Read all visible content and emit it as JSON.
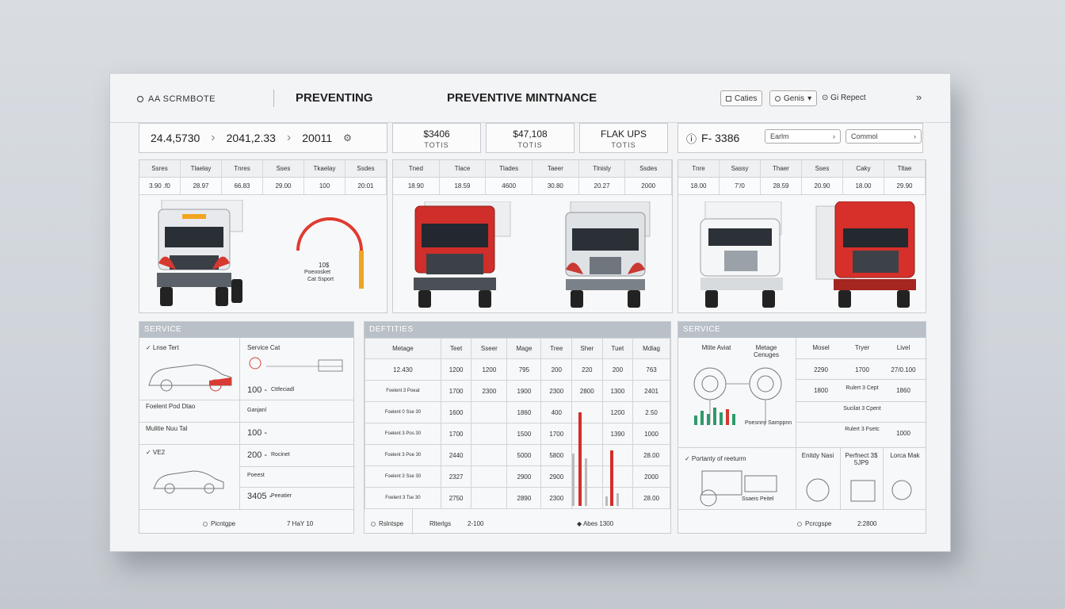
{
  "header": {
    "brand": "AA SCRMBOTE",
    "title_left": "PREVENTING",
    "title_main": "PREVENTIVE MINTNANCE",
    "btn1": "Caties",
    "btn2": "Genis",
    "link": "Gi Repect",
    "chevron": "»"
  },
  "metrics": [
    "24.4,5730",
    "2041,2.33",
    "20011"
  ],
  "cards": [
    {
      "value": "$3406",
      "sub": "TOTIS"
    },
    {
      "value": "$47,108",
      "sub": "TOTIS"
    },
    {
      "value": "FLAK UPS",
      "sub": "TOTIS"
    }
  ],
  "filter": {
    "id": "F- 3386",
    "select1": "Earlm",
    "select2": "Commol"
  },
  "truck_panels": [
    {
      "headers": [
        "Ssres",
        "Tlaelay",
        "Tnres",
        "Sses",
        "Tkaelay",
        "Ssdes"
      ],
      "values": [
        "3.90 .f0",
        "28.97",
        "66.83",
        "29.00",
        "100",
        "20:01"
      ]
    },
    {
      "headers": [
        "Tned",
        "Tlace",
        "Tlades",
        "Taeer",
        "Tlnisly",
        "Ssdes"
      ],
      "values": [
        "18.90",
        "18.59",
        "4600",
        "30.80",
        "20.27",
        "2000"
      ]
    },
    {
      "headers": [
        "Tnre",
        "Sassy",
        "Thaer",
        "Sses",
        "Caky",
        "Tltae"
      ],
      "values": [
        "18.00",
        "7'/0",
        "28.59",
        "20.90",
        "18.00",
        "29.90"
      ]
    }
  ],
  "gauge": {
    "value": "10$",
    "label1": "Poeoosket",
    "label2": "Cat Ssport"
  },
  "service_left": {
    "title": "SERVICE",
    "col1_head": "✓ Lnse Tert",
    "col2_head": "Service Cat",
    "rows": [
      {
        "left": "Foelent Pod Dtao",
        "right": "100 -",
        "rightsub": "Cttfeciadl"
      },
      {
        "left": "Mulitie Nuu Tal",
        "right": "100 -",
        "rightsub": "Ganjanl"
      },
      {
        "left": "✓ VE2",
        "right": "200 -",
        "rightsub": "Rocinet"
      },
      {
        "left": "",
        "right": "",
        "rightsub": "Poeest"
      },
      {
        "left": "",
        "right": "3405 -",
        "rightsub": "Peeatier"
      }
    ],
    "footer_left": "Picntgpe",
    "footer_right": "7 HaY 10"
  },
  "definitions": {
    "title": "DEFTITIES",
    "headers": [
      "Metage",
      "Teet",
      "Sseer",
      "Mage",
      "Tree",
      "Sher",
      "Tuet",
      "Mdlag"
    ],
    "rows": [
      [
        "12.430",
        "1200",
        "1200",
        "795",
        "200",
        "220",
        "200",
        "763"
      ],
      [
        "Foelent 3 Poeat",
        "1700",
        "2300",
        "1900",
        "2300",
        "2800",
        "1300",
        "2401"
      ],
      [
        "Foelent 0 Sse 30",
        "1600",
        "",
        "1860",
        "400",
        "",
        "1200",
        "2.50"
      ],
      [
        "Foelent 3 Pos 30",
        "1700",
        "",
        "1500",
        "1700",
        "",
        "1390",
        "1000"
      ],
      [
        "Foelent 3 Poe 30",
        "2440",
        "",
        "5000",
        "5800",
        "",
        "",
        "28.00"
      ],
      [
        "Foelent 3 Sse 30",
        "2327",
        "",
        "2900",
        "2900",
        "",
        "",
        "2000"
      ],
      [
        "Foelent 3 Tse 30",
        "2750",
        "",
        "2890",
        "2300",
        "",
        "",
        "28.00"
      ]
    ],
    "footer": [
      "Rslntspe",
      "Rlterlgs",
      "2-100",
      "Abes 1300"
    ]
  },
  "service_right": {
    "title": "SERVICE",
    "headers": [
      "Mtite Aviat",
      "Metage Cenuges",
      "Mosel",
      "Tryer",
      "Livel"
    ],
    "rows": [
      [
        "2290",
        "1700",
        "27/0.100"
      ],
      [
        "1800",
        "Rulert 3 Cept",
        "1860"
      ],
      [
        "",
        "Sucilat 3 Cpent",
        ""
      ],
      [
        "",
        "Rulert 3 Fsetc",
        "1000"
      ]
    ],
    "caption1": "Poesnny Samppnn",
    "row_title": "✓ Portanty of reeturm",
    "col_a": "Enitdy Nasi",
    "col_b": "Perfnect 3$ 5JP9",
    "col_c": "Lorca Mak",
    "caption2": "Ssaeis Peitel",
    "footer_left": "Pcrcgspe",
    "footer_right": "2:2800"
  }
}
